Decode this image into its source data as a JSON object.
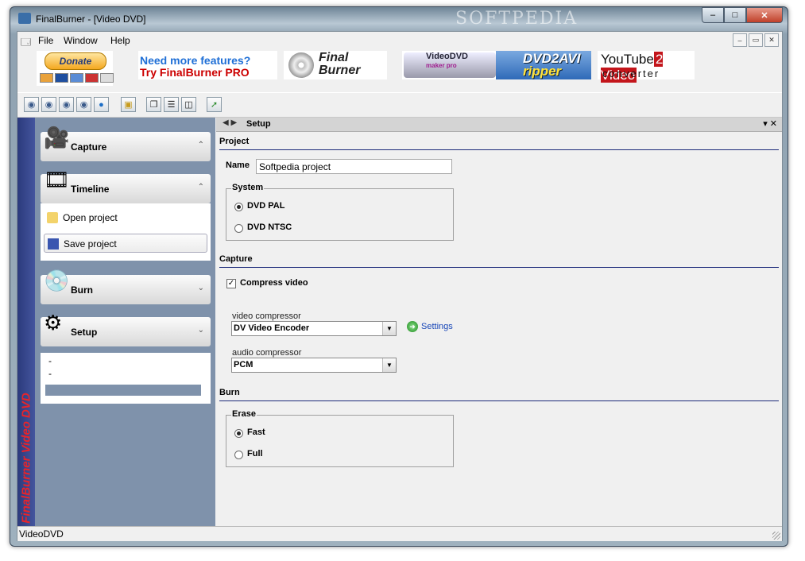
{
  "window": {
    "title": "FinalBurner - [Video DVD]",
    "watermark": "SOFTPEDIA",
    "buttons": {
      "minimize": "–",
      "maximize": "□",
      "close": "✕"
    }
  },
  "menu": {
    "items": [
      "File",
      "Window",
      "Help"
    ],
    "mdi_buttons": [
      "–",
      "▭",
      "✕"
    ]
  },
  "banner": {
    "donate": "Donate",
    "ad1_line1": "Need more features?",
    "ad1_line2": "Try FinalBurner PRO",
    "ad2_line1": "Final",
    "ad2_line2": "Burner",
    "ad3_line1": "VideoDVD",
    "ad3_line2": "maker pro",
    "ad4_line1": "DVD2AVI",
    "ad4_line2": "ripper",
    "ad5_prefix": "YouTube",
    "ad5_highlight": "2 Video",
    "ad5_line2": "converter"
  },
  "toolbar": {
    "icons": [
      "burn-disc-icon",
      "copy-disc-icon",
      "erase-disc-icon",
      "disc-info-icon",
      "web-icon",
      "open-folder-icon",
      "cascade-icon",
      "tile-horizontal-icon",
      "tile-vertical-icon",
      "run-icon"
    ]
  },
  "sidebar": {
    "vertical_title": "FinalBurner Video DVD",
    "groups": [
      {
        "label": "Capture",
        "chevron": "⌃"
      },
      {
        "label": "Timeline",
        "chevron": "⌃",
        "items": [
          "Open project",
          "Save project"
        ]
      },
      {
        "label": "Burn",
        "chevron": "⌄"
      },
      {
        "label": "Setup",
        "chevron": "⌄",
        "items": [
          "-",
          "-"
        ]
      }
    ]
  },
  "panel": {
    "title": "Setup",
    "nav_back": "◆",
    "nav_fwd": "◆",
    "right_controls": "▾ ✕",
    "project": {
      "section": "Project",
      "name_label": "Name",
      "name_value": "Softpedia project",
      "system_legend": "System",
      "options": [
        "DVD PAL",
        "DVD NTSC"
      ],
      "selected": "DVD PAL"
    },
    "capture": {
      "section": "Capture",
      "compress_label": "Compress video",
      "compress_checked": true,
      "video_label": "video compressor",
      "video_value": "DV Video Encoder",
      "settings_link": "Settings",
      "audio_label": "audio compressor",
      "audio_value": "PCM"
    },
    "burn": {
      "section": "Burn",
      "erase_legend": "Erase",
      "options": [
        "Fast",
        "Full"
      ],
      "selected": "Fast"
    }
  },
  "status": {
    "text": "VideoDVD"
  }
}
